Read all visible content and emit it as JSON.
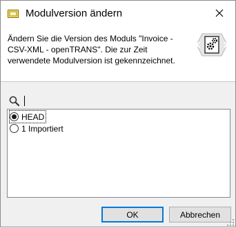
{
  "window": {
    "title": "Modulversion ändern",
    "app_icon": "window-icon",
    "close_icon": "close-icon"
  },
  "header": {
    "description": "Ändern Sie die Version des Moduls \"Invoice - CSV-XML - openTRANS\". Die zur Zeit verwendete Modulversion ist gekennzeichnet.",
    "graphic_icon": "module-gear-icon"
  },
  "search": {
    "icon": "search-icon",
    "value": ""
  },
  "versions": [
    {
      "label": "HEAD",
      "selected": true
    },
    {
      "label": "1 Importiert",
      "selected": false
    }
  ],
  "buttons": {
    "ok_label": "OK",
    "cancel_label": "Abbrechen"
  }
}
